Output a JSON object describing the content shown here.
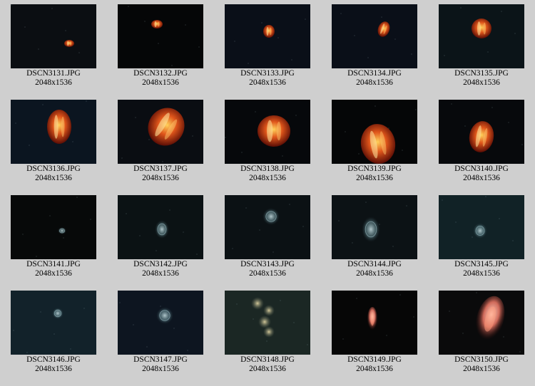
{
  "gallery": {
    "items": [
      {
        "filename": "DSCN3131.JPG",
        "dimensions": "2048x1536"
      },
      {
        "filename": "DSCN3132.JPG",
        "dimensions": "2048x1536"
      },
      {
        "filename": "DSCN3133.JPG",
        "dimensions": "2048x1536"
      },
      {
        "filename": "DSCN3134.JPG",
        "dimensions": "2048x1536"
      },
      {
        "filename": "DSCN3135.JPG",
        "dimensions": "2048x1536"
      },
      {
        "filename": "DSCN3136.JPG",
        "dimensions": "2048x1536"
      },
      {
        "filename": "DSCN3137.JPG",
        "dimensions": "2048x1536"
      },
      {
        "filename": "DSCN3138.JPG",
        "dimensions": "2048x1536"
      },
      {
        "filename": "DSCN3139.JPG",
        "dimensions": "2048x1536"
      },
      {
        "filename": "DSCN3140.JPG",
        "dimensions": "2048x1536"
      },
      {
        "filename": "DSCN3141.JPG",
        "dimensions": "2048x1536"
      },
      {
        "filename": "DSCN3142.JPG",
        "dimensions": "2048x1536"
      },
      {
        "filename": "DSCN3143.JPG",
        "dimensions": "2048x1536"
      },
      {
        "filename": "DSCN3144.JPG",
        "dimensions": "2048x1536"
      },
      {
        "filename": "DSCN3145.JPG",
        "dimensions": "2048x1536"
      },
      {
        "filename": "DSCN3146.JPG",
        "dimensions": "2048x1536"
      },
      {
        "filename": "DSCN3147.JPG",
        "dimensions": "2048x1536"
      },
      {
        "filename": "DSCN3148.JPG",
        "dimensions": "2048x1536"
      },
      {
        "filename": "DSCN3149.JPG",
        "dimensions": "2048x1536"
      },
      {
        "filename": "DSCN3150.JPG",
        "dimensions": "2048x1536"
      }
    ]
  }
}
